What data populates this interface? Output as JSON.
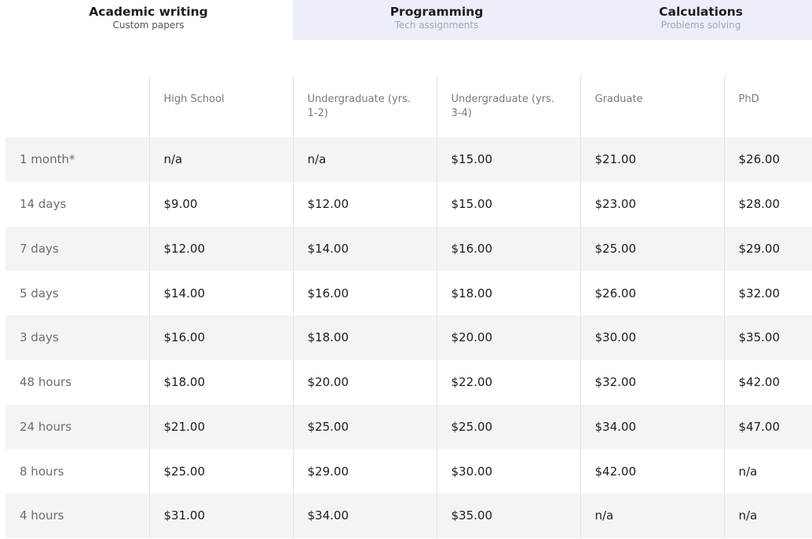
{
  "tabs": [
    {
      "title": "Academic writing",
      "subtitle": "Custom papers",
      "active": true
    },
    {
      "title": "Programming",
      "subtitle": "Tech assignments",
      "active": false
    },
    {
      "title": "Calculations",
      "subtitle": "Problems solving",
      "active": false
    }
  ],
  "table": {
    "columns": [
      "",
      "High School",
      "Undergraduate (yrs. 1-2)",
      "Undergraduate (yrs. 3-4)",
      "Graduate",
      "PhD"
    ],
    "rows": [
      {
        "deadline": "1 month*",
        "prices": [
          "n/a",
          "n/a",
          "$15.00",
          "$21.00",
          "$26.00"
        ]
      },
      {
        "deadline": "14 days",
        "prices": [
          "$9.00",
          "$12.00",
          "$15.00",
          "$23.00",
          "$28.00"
        ]
      },
      {
        "deadline": "7 days",
        "prices": [
          "$12.00",
          "$14.00",
          "$16.00",
          "$25.00",
          "$29.00"
        ]
      },
      {
        "deadline": "5 days",
        "prices": [
          "$14.00",
          "$16.00",
          "$18.00",
          "$26.00",
          "$32.00"
        ]
      },
      {
        "deadline": "3 days",
        "prices": [
          "$16.00",
          "$18.00",
          "$20.00",
          "$30.00",
          "$35.00"
        ]
      },
      {
        "deadline": "48 hours",
        "prices": [
          "$18.00",
          "$20.00",
          "$22.00",
          "$32.00",
          "$42.00"
        ]
      },
      {
        "deadline": "24 hours",
        "prices": [
          "$21.00",
          "$25.00",
          "$25.00",
          "$34.00",
          "$47.00"
        ]
      },
      {
        "deadline": "8 hours",
        "prices": [
          "$25.00",
          "$29.00",
          "$30.00",
          "$42.00",
          "n/a"
        ]
      },
      {
        "deadline": "4 hours",
        "prices": [
          "$31.00",
          "$34.00",
          "$35.00",
          "n/a",
          "n/a"
        ]
      }
    ]
  },
  "colors": {
    "inactive_tab_bg": "#eceff9",
    "striped_row_bg": "#f4f4f4",
    "grid_line": "#e3e3e3"
  }
}
